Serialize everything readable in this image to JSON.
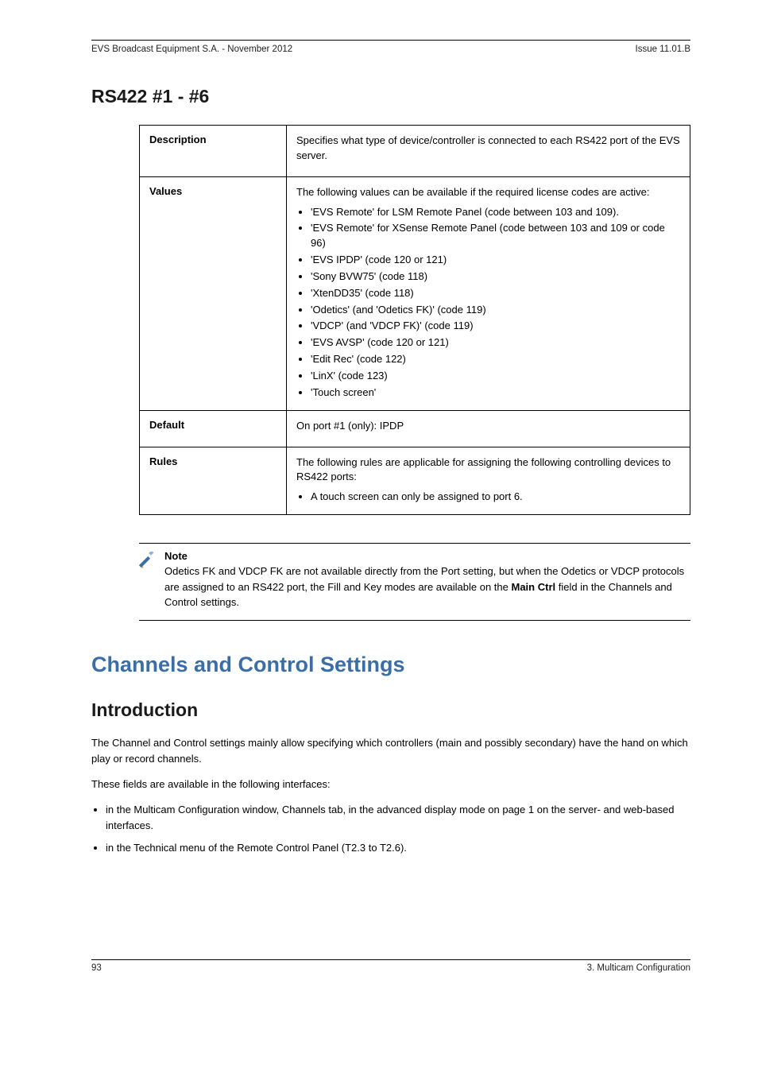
{
  "header": {
    "left": "EVS Broadcast Equipment S.A.  - November 2012",
    "right": "Issue 11.01.B"
  },
  "section_title": "RS422 #1 - #6",
  "table": {
    "description": {
      "label": "Description",
      "text": "Specifies what type of device/controller is connected to each RS422 port of the EVS server."
    },
    "values": {
      "label": "Values",
      "intro": "The following values can be available if the required license codes are active:",
      "items": [
        "'EVS Remote' for LSM Remote Panel (code between 103 and 109).",
        "'EVS Remote' for XSense Remote Panel (code between 103 and 109 or code 96)",
        "'EVS IPDP' (code 120 or 121)",
        "'Sony BVW75' (code 118)",
        "'XtenDD35' (code 118)",
        "'Odetics' (and 'Odetics FK)' (code 119)",
        "'VDCP' (and 'VDCP FK)' (code 119)",
        "'EVS AVSP' (code 120 or 121)",
        "'Edit Rec' (code 122)",
        "'LinX' (code 123)",
        "'Touch screen'"
      ]
    },
    "default": {
      "label": "Default",
      "text": "On port #1 (only): IPDP"
    },
    "rules": {
      "label": "Rules",
      "intro": "The following rules are applicable for assigning the following controlling devices to RS422 ports:",
      "items": [
        "A touch screen can only be assigned to port 6."
      ]
    }
  },
  "note": {
    "label": "Note",
    "text_pre": "Odetics FK and VDCP FK are not available directly from the Port setting, but when the Odetics or VDCP protocols are assigned to an RS422 port, the Fill and Key modes are available on the ",
    "bold": "Main Ctrl",
    "text_post": " field in the Channels and Control settings."
  },
  "channels_heading": "Channels and Control Settings",
  "intro_heading": "Introduction",
  "intro_p1": "The Channel and Control settings mainly allow specifying which controllers (main and possibly secondary) have the hand on which play or record channels.",
  "intro_p2": "These fields are available in the following interfaces:",
  "intro_list": [
    "in the Multicam Configuration window, Channels tab, in the advanced display mode on page 1 on the server- and web-based interfaces.",
    "in the Technical menu of the Remote Control Panel (T2.3 to T2.6)."
  ],
  "footer": {
    "left": "93",
    "right": "3. Multicam Configuration"
  }
}
